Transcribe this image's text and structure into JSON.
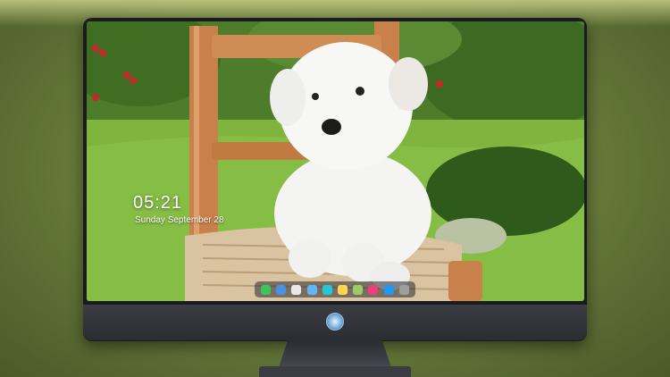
{
  "lock_screen": {
    "time": "05:21",
    "date": "Sunday September  28"
  },
  "dock": {
    "items": [
      {
        "name": "messages-icon",
        "color": "#3ec45a"
      },
      {
        "name": "finder-icon",
        "color": "#4a90e2"
      },
      {
        "name": "chrome-icon",
        "color": "#e8e8e8"
      },
      {
        "name": "folder-icon",
        "color": "#64b5f6"
      },
      {
        "name": "video-icon",
        "color": "#26c6da"
      },
      {
        "name": "notes-icon",
        "color": "#ffd54f"
      },
      {
        "name": "photos-icon",
        "color": "#9ccc65"
      },
      {
        "name": "music-icon",
        "color": "#ec407a"
      },
      {
        "name": "app-store-icon",
        "color": "#2196f3"
      },
      {
        "name": "camera-icon",
        "color": "#9e9e9e"
      }
    ]
  },
  "colors": {
    "monitor_frame": "#1a1b1f",
    "chin": "#33353b"
  }
}
